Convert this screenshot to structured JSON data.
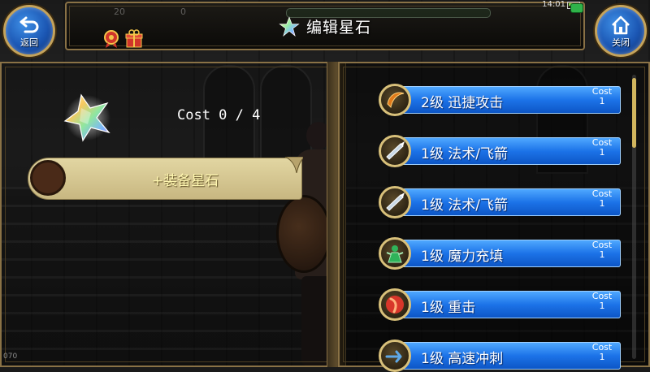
{
  "header": {
    "title": "编辑星石",
    "back_label": "返回",
    "close_label": "关闭",
    "ghost_level_text": "20",
    "ghost_zero_text": "0"
  },
  "status_bar": {
    "time": "14:01"
  },
  "left_panel": {
    "cost_text": "Cost 0 / 4",
    "equip_button_label": "+装备星石",
    "version_text": "070"
  },
  "stones": [
    {
      "label": "2级 迅捷攻击",
      "cost_label": "Cost",
      "cost_value": "1",
      "icon": "swift-attack-icon",
      "icon_color": "#e07a1a"
    },
    {
      "label": "1级 法术/飞箭",
      "cost_label": "Cost",
      "cost_value": "1",
      "icon": "spell-arrow-icon",
      "icon_color": "#c9d9e6"
    },
    {
      "label": "1级 法术/飞箭",
      "cost_label": "Cost",
      "cost_value": "1",
      "icon": "spell-arrow-icon",
      "icon_color": "#c9d9e6"
    },
    {
      "label": "1级 魔力充填",
      "cost_label": "Cost",
      "cost_value": "1",
      "icon": "mana-fill-icon",
      "icon_color": "#2fb35a"
    },
    {
      "label": "1级 重击",
      "cost_label": "Cost",
      "cost_value": "1",
      "icon": "heavy-strike-icon",
      "icon_color": "#d8362a"
    },
    {
      "label": "1级 高速冲刺",
      "cost_label": "Cost",
      "cost_value": "1",
      "icon": "dash-icon",
      "icon_color": "#5fa8e6"
    }
  ],
  "colors": {
    "frame_gold": "#8a7246",
    "list_blue": "#1c73e8",
    "button_blue": "#1b56b3"
  }
}
